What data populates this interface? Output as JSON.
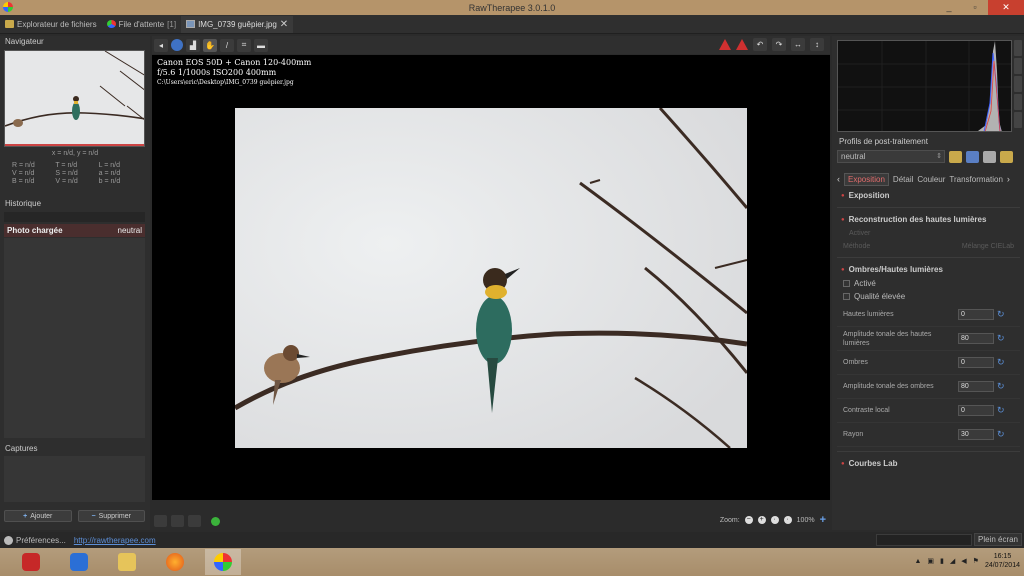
{
  "window": {
    "title": "RawTherapee 3.0.1.0",
    "controls": [
      "_",
      "▫",
      "✕"
    ]
  },
  "tabs": [
    {
      "label": "Explorateur de fichiers"
    },
    {
      "label": "File d'attente",
      "count": "[1]"
    },
    {
      "label": "IMG_0739 guêpier.jpg",
      "close": "✕"
    }
  ],
  "navigator": {
    "title": "Navigateur",
    "coords": "x = n/d, y = n/d",
    "values": [
      "R = n/d",
      "T = n/d",
      "L = n/d",
      "V = n/d",
      "S = n/d",
      "a = n/d",
      "B = n/d",
      "V = n/d",
      "b = n/d"
    ]
  },
  "history": {
    "title": "Historique",
    "rows": [
      {
        "label": "Photo chargée",
        "value": "neutral"
      }
    ]
  },
  "captures": {
    "title": "Captures",
    "add": "Ajouter",
    "remove": "Supprimer"
  },
  "viewer": {
    "exif_line1": "Canon EOS 50D + Canon 120-400mm",
    "exif_line2": "f/5.6  1/1000s  ISO200  400mm",
    "exif_path": "C:\\Users\\eric\\Desktop\\IMG_0739 guêpier.jpg",
    "zoom_label": "Zoom:",
    "zoom_value": "100%"
  },
  "profiles": {
    "title": "Profils de post-traitement",
    "selected": "neutral"
  },
  "tool_tabs": [
    "Exposition",
    "Détail",
    "Couleur",
    "Transformation"
  ],
  "tools": {
    "exposure": "Exposition",
    "highlight_recon": "Reconstruction des hautes lumières",
    "hr_active": "Activer",
    "hr_method_label": "Méthode",
    "hr_method_value": "Mélange CIELab",
    "shadows_hl": "Ombres/Hautes lumières",
    "sh_active": "Activé",
    "sh_hq": "Qualité élevée",
    "sliders": [
      {
        "label": "Hautes lumières",
        "value": "0"
      },
      {
        "label": "Amplitude tonale des hautes lumières",
        "value": "80"
      },
      {
        "label": "Ombres",
        "value": "0"
      },
      {
        "label": "Amplitude tonale des ombres",
        "value": "80"
      },
      {
        "label": "Contraste local",
        "value": "0"
      },
      {
        "label": "Rayon",
        "value": "30"
      }
    ],
    "lab_curves": "Courbes Lab"
  },
  "statusbar": {
    "preferences": "Préférences...",
    "link": "http://rawtherapee.com",
    "fullscreen": "Plein écran"
  },
  "taskbar": {
    "time": "16:15",
    "date": "24/07/2014"
  }
}
